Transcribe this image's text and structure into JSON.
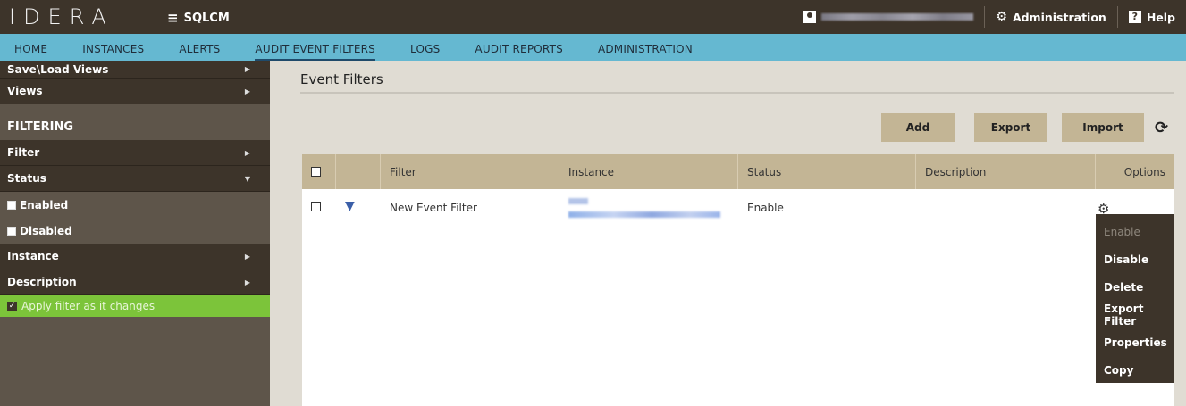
{
  "app": {
    "logo": "IDERA",
    "module": "SQLCM"
  },
  "topbar": {
    "administration": "Administration",
    "help": "Help"
  },
  "nav": {
    "tabs": [
      "HOME",
      "INSTANCES",
      "ALERTS",
      "AUDIT EVENT FILTERS",
      "LOGS",
      "AUDIT REPORTS",
      "ADMINISTRATION"
    ],
    "active": "AUDIT EVENT FILTERS"
  },
  "sidebar": {
    "save_load_views": "Save\\Load Views",
    "views": "Views",
    "filtering": "FILTERING",
    "filter": "Filter",
    "status": "Status",
    "enabled": "Enabled",
    "disabled": "Disabled",
    "instance": "Instance",
    "description": "Description",
    "apply_filter": "Apply filter as it changes"
  },
  "main": {
    "title": "Event Filters",
    "buttons": {
      "add": "Add",
      "export": "Export",
      "import": "Import"
    },
    "table": {
      "headers": [
        "Filter",
        "Instance",
        "Status",
        "Description",
        "Options"
      ],
      "rows": [
        {
          "filter": "New Event Filter",
          "status": "Enable",
          "description": ""
        }
      ]
    },
    "options_menu": [
      "Enable",
      "Disable",
      "Delete",
      "Export Filter",
      "Properties",
      "Copy"
    ]
  },
  "colors": {
    "topbar": "#3d342a",
    "nav": "#65b8d1",
    "sidebar": "#5e554a",
    "button": "#c3b595",
    "apply_bar": "#7cc43a"
  }
}
